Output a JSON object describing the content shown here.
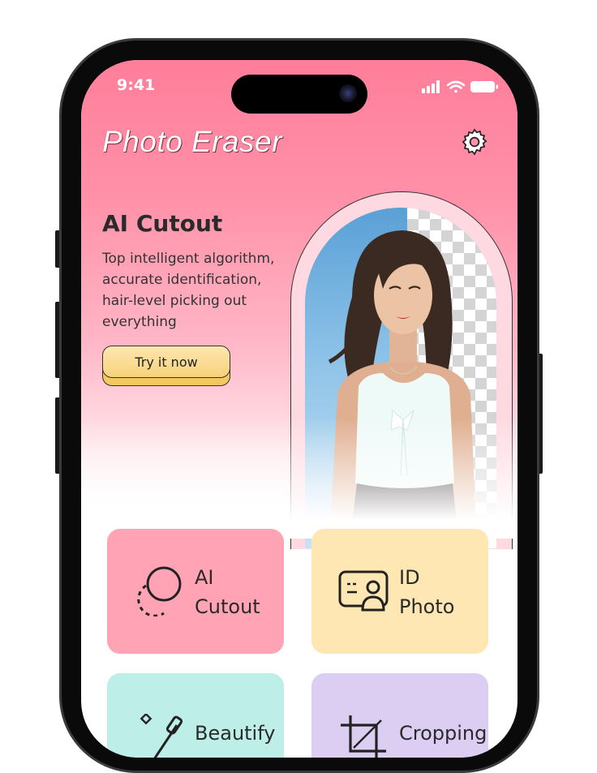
{
  "status_bar": {
    "time": "9:41"
  },
  "header": {
    "title": "Photo Eraser",
    "settings_icon": "gear-icon"
  },
  "hero": {
    "title": "AI Cutout",
    "description": "Top intelligent algorithm, accurate identification, hair-level picking out everything",
    "cta_label": "Try it now"
  },
  "features": [
    {
      "line1": "AI",
      "line2": "Cutout",
      "icon": "cutout-icon",
      "color": "#ffa3b5"
    },
    {
      "line1": "ID",
      "line2": "Photo",
      "icon": "id-photo-icon",
      "color": "#fee7b3"
    },
    {
      "line1": "Beautify",
      "line2": "",
      "icon": "beautify-wand-icon",
      "color": "#bdeee8"
    },
    {
      "line1": "Cropping",
      "line2": "",
      "icon": "crop-icon",
      "color": "#dccdf3"
    }
  ]
}
